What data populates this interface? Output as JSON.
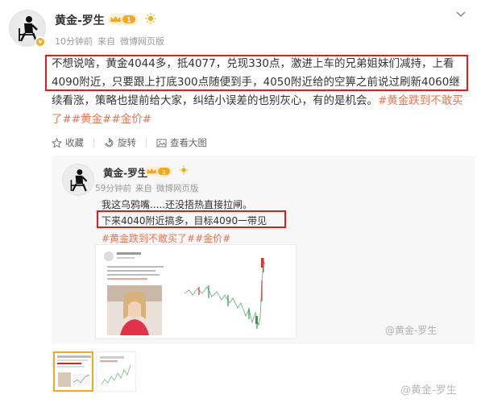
{
  "post": {
    "author": "黄金-罗生",
    "vip_level": "1",
    "meta": {
      "time": "10分钟前",
      "source_prefix": "来自",
      "source": "微博网页版"
    },
    "text_highlighted": "不想说啥，黄金4044多，抵4077，兑现330点，激进上车的兄弟姐妹们减持，上看4090附近，只要跟上打底300点随便到手，4050附近给的空箅之前说过刷新",
    "text_rest": "4060继续看涨，策略也提前给大家，纠结小误差的也别灰心，有的是机会。",
    "hashtags": "#黄金跌到不敢买了##黄金##金价#"
  },
  "actions": {
    "collect": "收藏",
    "forward": "旋转",
    "view_image": "查看大图"
  },
  "quoted": {
    "author": "黄金-罗生",
    "vip_level": "1",
    "meta": {
      "time": "59分钟前",
      "source_prefix": "来自",
      "source": "微博网页版"
    },
    "line1": "我这乌鸦嘴.....还没捂热直接拉闸。",
    "line2": "下来4040附近搞多，目标4090一带见",
    "hashtags": "#黄金跌到不敢买了##金价#",
    "watermark": "@黄金-罗生"
  },
  "watermark": "@黄金-罗生",
  "colors": {
    "highlight_box": "#e21b1b",
    "hashtag": "#eb7350",
    "badge": "#f5a623",
    "chart_up": "#2e9e4b",
    "chart_down": "#d23a3a"
  },
  "icons": [
    "chevron-down-icon",
    "star-icon",
    "forward-icon",
    "image-icon",
    "sun-icon",
    "vip-icon",
    "verified-icon"
  ]
}
